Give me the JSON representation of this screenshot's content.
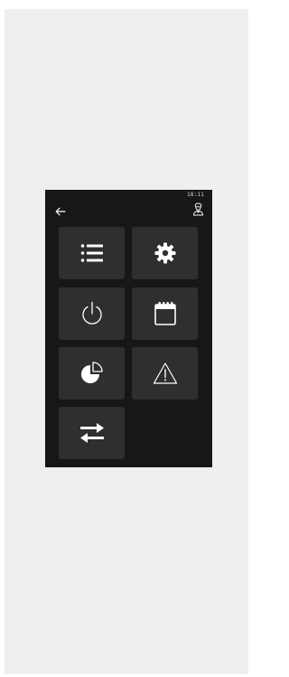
{
  "status_bar": {
    "time": "18:11"
  },
  "header": {
    "back_icon": "arrow-left-icon",
    "user_icon": "chef-user-icon"
  },
  "menu": {
    "tiles": [
      {
        "id": "list",
        "icon": "list-icon"
      },
      {
        "id": "settings",
        "icon": "gear-icon"
      },
      {
        "id": "power",
        "icon": "power-icon"
      },
      {
        "id": "calendar",
        "icon": "calendar-icon"
      },
      {
        "id": "statistics",
        "icon": "pie-chart-icon"
      },
      {
        "id": "alarms",
        "icon": "warning-icon"
      },
      {
        "id": "transfer",
        "icon": "transfer-arrows-icon"
      }
    ]
  },
  "colors": {
    "screen_background": "#17171a",
    "tile_background": "#2f2e31",
    "icon": "#ffffff",
    "page_background": "#efefef"
  }
}
